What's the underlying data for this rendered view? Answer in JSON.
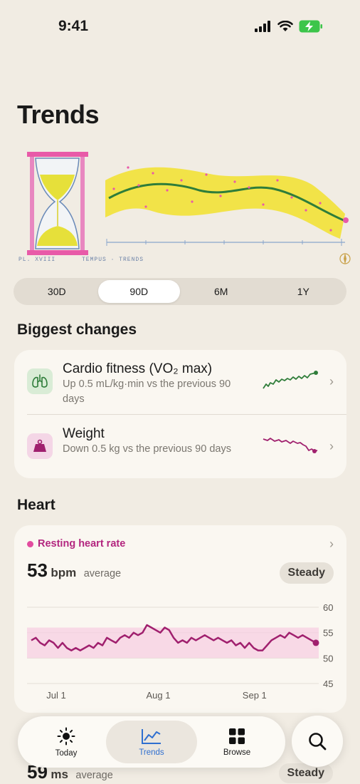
{
  "status": {
    "time": "9:41"
  },
  "page": {
    "title": "Trends"
  },
  "hero": {
    "caption_left": "PL. XVIII",
    "caption_right": "TEMPUS · TRENDS"
  },
  "ranges": {
    "options": [
      "30D",
      "90D",
      "6M",
      "1Y"
    ],
    "selected": "90D"
  },
  "biggest_changes": {
    "title": "Biggest changes",
    "items": [
      {
        "title": "Cardio fitness (VO₂ max)",
        "desc": "Up 0.5 mL/kg·min vs the previous 90 days",
        "icon": "lungs-icon",
        "color": "#2f7d3a"
      },
      {
        "title": "Weight",
        "desc": "Down 0.5 kg vs the previous 90 days",
        "icon": "weight-icon",
        "color": "#a0206e"
      }
    ]
  },
  "heart": {
    "title": "Heart",
    "metric": "Resting heart rate",
    "value": "53",
    "unit": "bpm",
    "average_label": "average",
    "status": "Steady",
    "accent": "#b3267f"
  },
  "chart_data": {
    "type": "line",
    "x_ticks": [
      "Jul 1",
      "Aug 1",
      "Sep 1"
    ],
    "y_ticks": [
      60,
      55,
      50,
      45
    ],
    "ylim": [
      45,
      60
    ],
    "band": [
      50,
      56
    ],
    "series": [
      {
        "values": [
          53.5,
          54,
          53,
          52.5,
          53.5,
          53,
          52,
          53,
          52,
          51.5,
          52,
          51.5,
          52,
          52.5,
          52,
          53,
          52.5,
          54,
          53.5,
          53,
          54,
          54.5,
          54,
          55,
          54.5,
          55,
          56.5,
          56,
          55.5,
          55,
          56,
          55.5,
          54,
          53,
          53.5,
          53,
          54,
          53.5,
          54,
          54.5,
          54,
          53.5,
          54,
          53.5,
          53,
          53.5,
          52.5,
          53,
          52,
          53,
          52,
          51.5,
          51.5,
          52.5,
          53.5,
          54,
          54.5,
          54,
          55,
          54.5,
          54,
          54.5,
          54,
          53.5,
          53
        ]
      }
    ]
  },
  "peek": {
    "value": "59",
    "unit": "ms",
    "average_label": "average",
    "status": "Steady"
  },
  "tabs": [
    {
      "label": "Today",
      "icon": "sun-icon"
    },
    {
      "label": "Trends",
      "icon": "chart-icon"
    },
    {
      "label": "Browse",
      "icon": "grid-icon"
    }
  ],
  "colors": {
    "background": "#f1ece3",
    "card": "#faf7f1",
    "tab_active": "#2f6fd0"
  }
}
